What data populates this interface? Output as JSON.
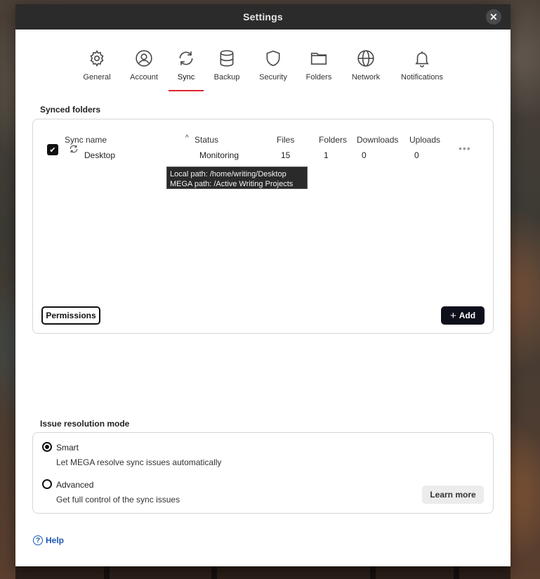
{
  "window": {
    "title": "Settings",
    "close_glyph": "✕"
  },
  "tabs": [
    {
      "label": "General",
      "icon": "gear-icon"
    },
    {
      "label": "Account",
      "icon": "account-icon"
    },
    {
      "label": "Sync",
      "icon": "sync-icon",
      "active": true
    },
    {
      "label": "Backup",
      "icon": "database-icon"
    },
    {
      "label": "Security",
      "icon": "shield-icon"
    },
    {
      "label": "Folders",
      "icon": "folder-icon"
    },
    {
      "label": "Network",
      "icon": "globe-icon"
    },
    {
      "label": "Notifications",
      "icon": "bell-icon"
    }
  ],
  "synced_folders": {
    "title": "Synced folders",
    "columns": {
      "sync_name": "Sync name",
      "status": "Status",
      "files": "Files",
      "folders": "Folders",
      "downloads": "Downloads",
      "uploads": "Uploads"
    },
    "sort_indicator": "^",
    "rows": [
      {
        "name": "Desktop",
        "status": "Monitoring",
        "files": "15",
        "folders": "1",
        "downloads": "0",
        "uploads": "0",
        "checked": true
      }
    ],
    "tooltip": {
      "local_path": "Local path: /home/writing/Desktop",
      "mega_path": "MEGA path: /Active Writing Projects"
    },
    "permissions_button": "Permissions",
    "add_button": "Add",
    "add_glyph": "+"
  },
  "issue_resolution": {
    "title": "Issue resolution mode",
    "options": [
      {
        "label": "Smart",
        "description": "Let MEGA resolve sync issues automatically",
        "selected": true
      },
      {
        "label": "Advanced",
        "description": "Get full control of the sync issues",
        "selected": false
      }
    ],
    "learn_more": "Learn more"
  },
  "footer": {
    "help": "Help",
    "help_glyph": "?"
  },
  "colors": {
    "accent": "#d9272e",
    "link": "#1b55b5",
    "titlebar": "#2b2b2b"
  }
}
